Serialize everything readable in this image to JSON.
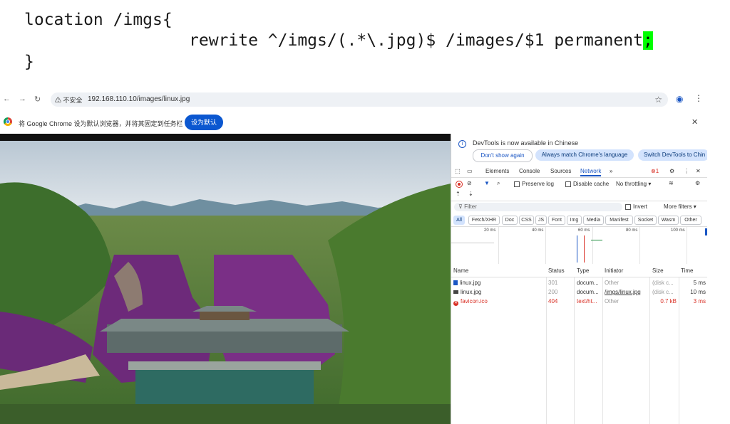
{
  "code": {
    "line1": "location /imgs{",
    "line2": "rewrite ^/imgs/(.*\\.jpg)$ /images/$1 permanent",
    "line2_cursor": ";",
    "line3": "}"
  },
  "browser": {
    "security_label": "不安全",
    "url": "192.168.110.10/images/linux.jpg",
    "infobar_text": "将 Google Chrome 设为默认浏览器，并将其固定到任务栏",
    "infobar_button": "设为默认"
  },
  "devtools": {
    "banner_title": "DevTools is now available in Chinese",
    "banner_buttons": [
      "Don't show again",
      "Always match Chrome's language",
      "Switch DevTools to Chin"
    ],
    "tabs": [
      "Elements",
      "Console",
      "Sources",
      "Network"
    ],
    "active_tab": "Network",
    "error_count": "1",
    "toolbar": {
      "preserve_log": "Preserve log",
      "disable_cache": "Disable cache",
      "throttling": "No throttling"
    },
    "filter": {
      "placeholder": "Filter",
      "invert": "Invert",
      "more_filters": "More filters"
    },
    "type_filters": [
      "All",
      "Fetch/XHR",
      "Doc",
      "CSS",
      "JS",
      "Font",
      "Img",
      "Media",
      "Manifest",
      "Socket",
      "Wasm",
      "Other"
    ],
    "timeline_ticks": [
      "20 ms",
      "40 ms",
      "60 ms",
      "80 ms",
      "100 ms"
    ],
    "columns": [
      "Name",
      "Status",
      "Type",
      "Initiator",
      "Size",
      "Time"
    ],
    "rows": [
      {
        "name": "linux.jpg",
        "status": "301",
        "type": "docum...",
        "initiator": "Other",
        "size": "(disk c...",
        "time": "5 ms",
        "icon": "doc"
      },
      {
        "name": "linux.jpg",
        "status": "200",
        "type": "docum...",
        "initiator": "/imgs/linux.jpg",
        "size": "(disk c...",
        "time": "10 ms",
        "icon": "img"
      },
      {
        "name": "favicon.ico",
        "status": "404",
        "type": "text/ht...",
        "initiator": "Other",
        "size": "0.7 kB",
        "time": "3 ms",
        "icon": "error"
      }
    ]
  },
  "colors": {
    "accent": "#1a56c4",
    "error": "#d93025",
    "highlight": "#00ff00"
  }
}
